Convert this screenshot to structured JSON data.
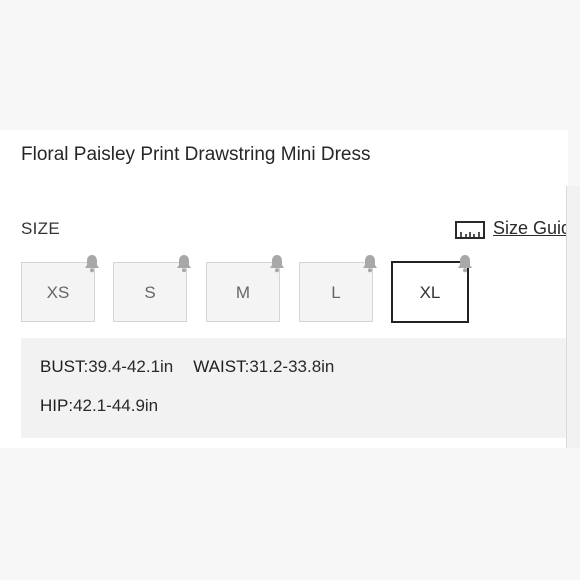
{
  "product": {
    "title": "Floral Paisley Print Drawstring Mini Dress"
  },
  "size_selector": {
    "label": "SIZE",
    "size_guide_label": "Size Guide",
    "sizes": [
      {
        "label": "XS",
        "selected": false
      },
      {
        "label": "S",
        "selected": false
      },
      {
        "label": "M",
        "selected": false
      },
      {
        "label": "L",
        "selected": false
      },
      {
        "label": "XL",
        "selected": true
      }
    ],
    "notify_icon": "bell-icon",
    "size_guide_icon": "ruler-icon"
  },
  "measurements": {
    "bust_label": "BUST",
    "bust_value": ":39.4-42.1in",
    "waist_label": "WAIST",
    "waist_value": ":31.2-33.8in",
    "hip_label": "HIP",
    "hip_value": ":42.1-44.9in"
  },
  "colors": {
    "selected_border": "#222222",
    "bell": "#a8a8a8",
    "measure_bg": "#f2f2f2"
  }
}
